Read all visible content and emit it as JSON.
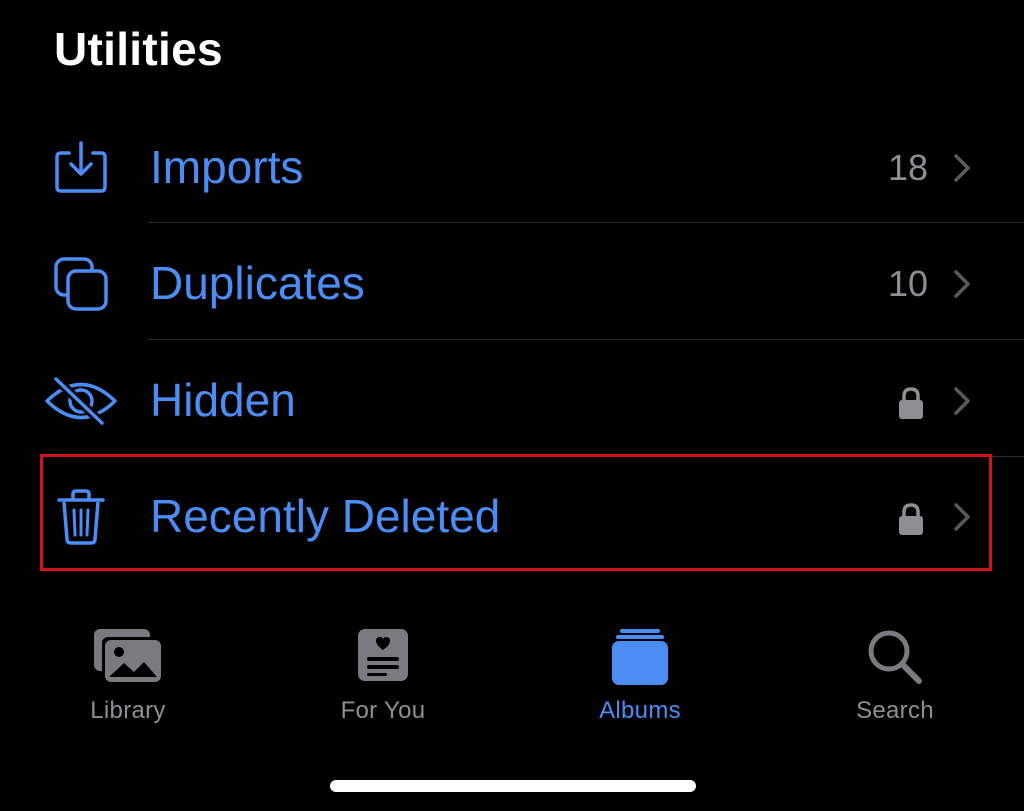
{
  "section": {
    "title": "Utilities"
  },
  "rows": [
    {
      "label": "Imports",
      "count": "18",
      "icon": "import-tray-icon",
      "locked": false
    },
    {
      "label": "Duplicates",
      "count": "10",
      "icon": "duplicates-icon",
      "locked": false
    },
    {
      "label": "Hidden",
      "count": "",
      "icon": "eye-slash-icon",
      "locked": true
    },
    {
      "label": "Recently Deleted",
      "count": "",
      "icon": "trash-icon",
      "locked": true
    }
  ],
  "tabs": [
    {
      "label": "Library",
      "icon": "photo-library-icon",
      "active": false
    },
    {
      "label": "For You",
      "icon": "for-you-icon",
      "active": false
    },
    {
      "label": "Albums",
      "icon": "albums-icon",
      "active": true
    },
    {
      "label": "Search",
      "icon": "search-icon",
      "active": false
    }
  ],
  "colors": {
    "background": "#000000",
    "accent": "#4c8df5",
    "secondary": "#8e8e93",
    "highlight": "#d0121b",
    "tab_inactive_icon": "#7a7a7f"
  }
}
